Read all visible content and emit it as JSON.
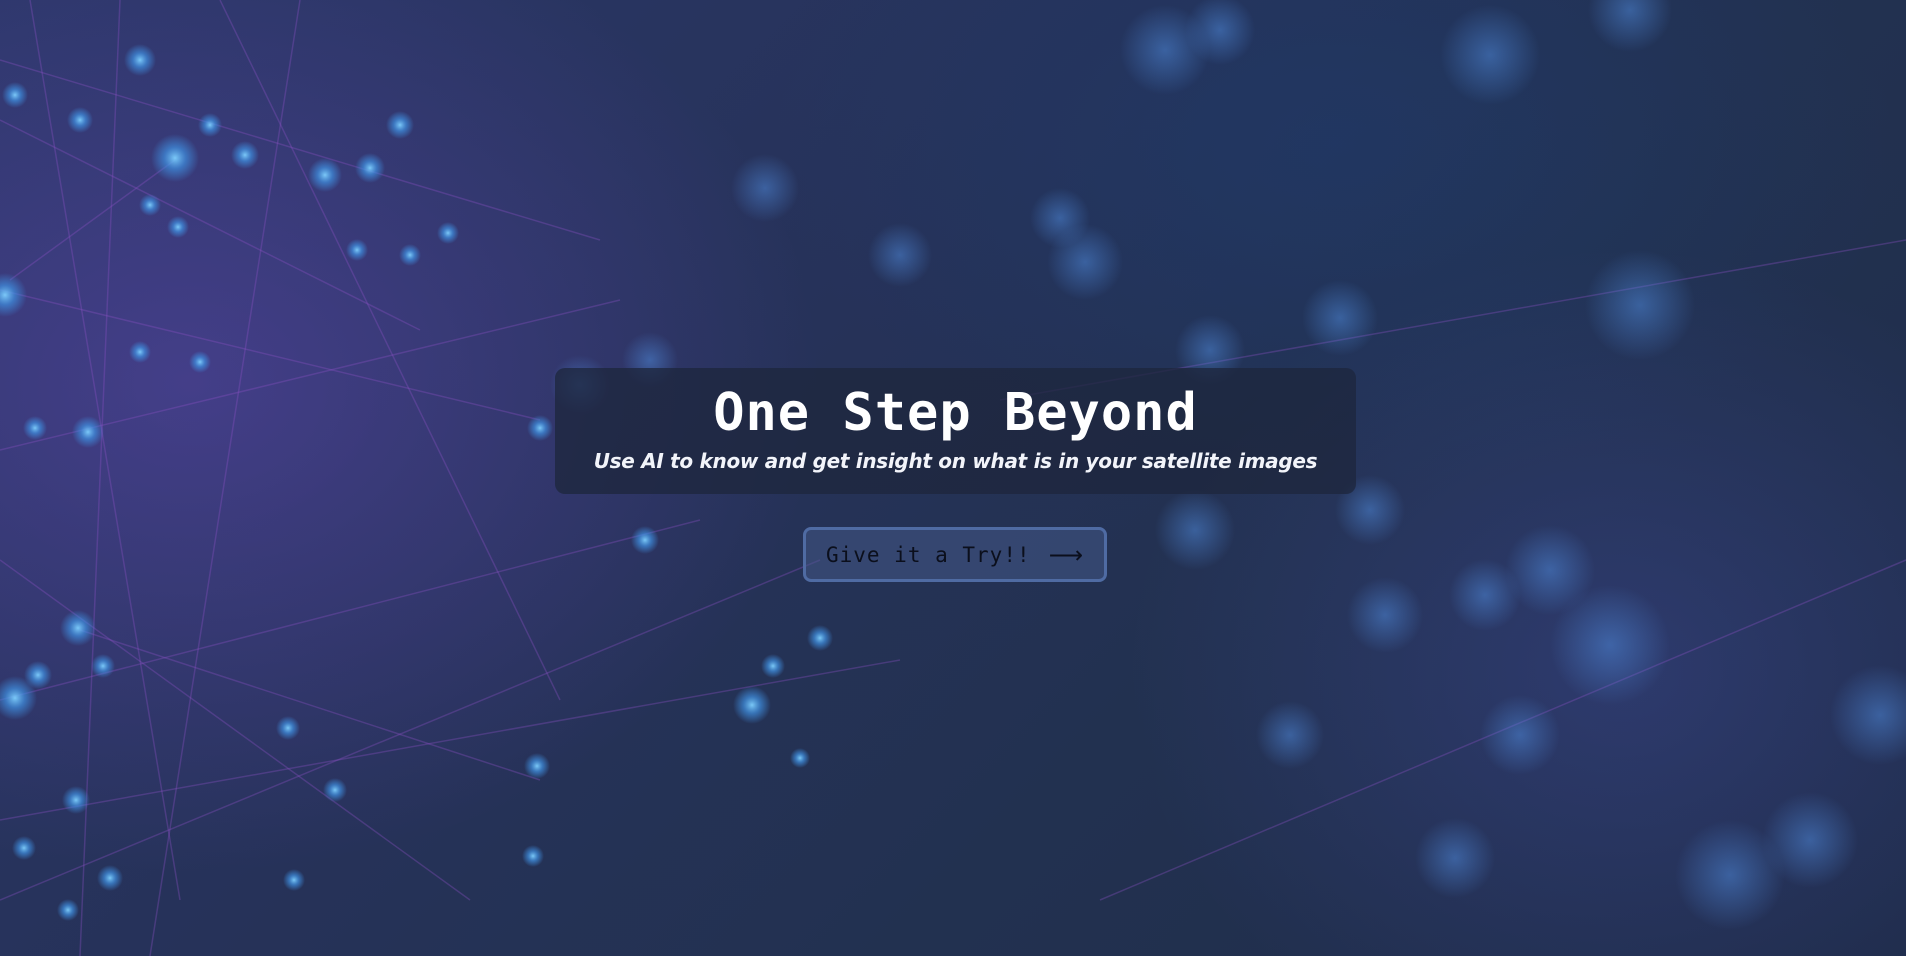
{
  "hero": {
    "title": "One Step Beyond",
    "subtitle": "Use AI to know and get insight on what is in your satellite images"
  },
  "cta": {
    "label": "Give it a Try!!",
    "icon": "arrow-right-icon",
    "arrow_glyph": "⟶"
  },
  "colors": {
    "background": "#263259",
    "panel": "#1e263e",
    "button_border": "#4f6ba3",
    "node_glow": "#3f8fe0",
    "line_purple": "#8a4fc4"
  }
}
